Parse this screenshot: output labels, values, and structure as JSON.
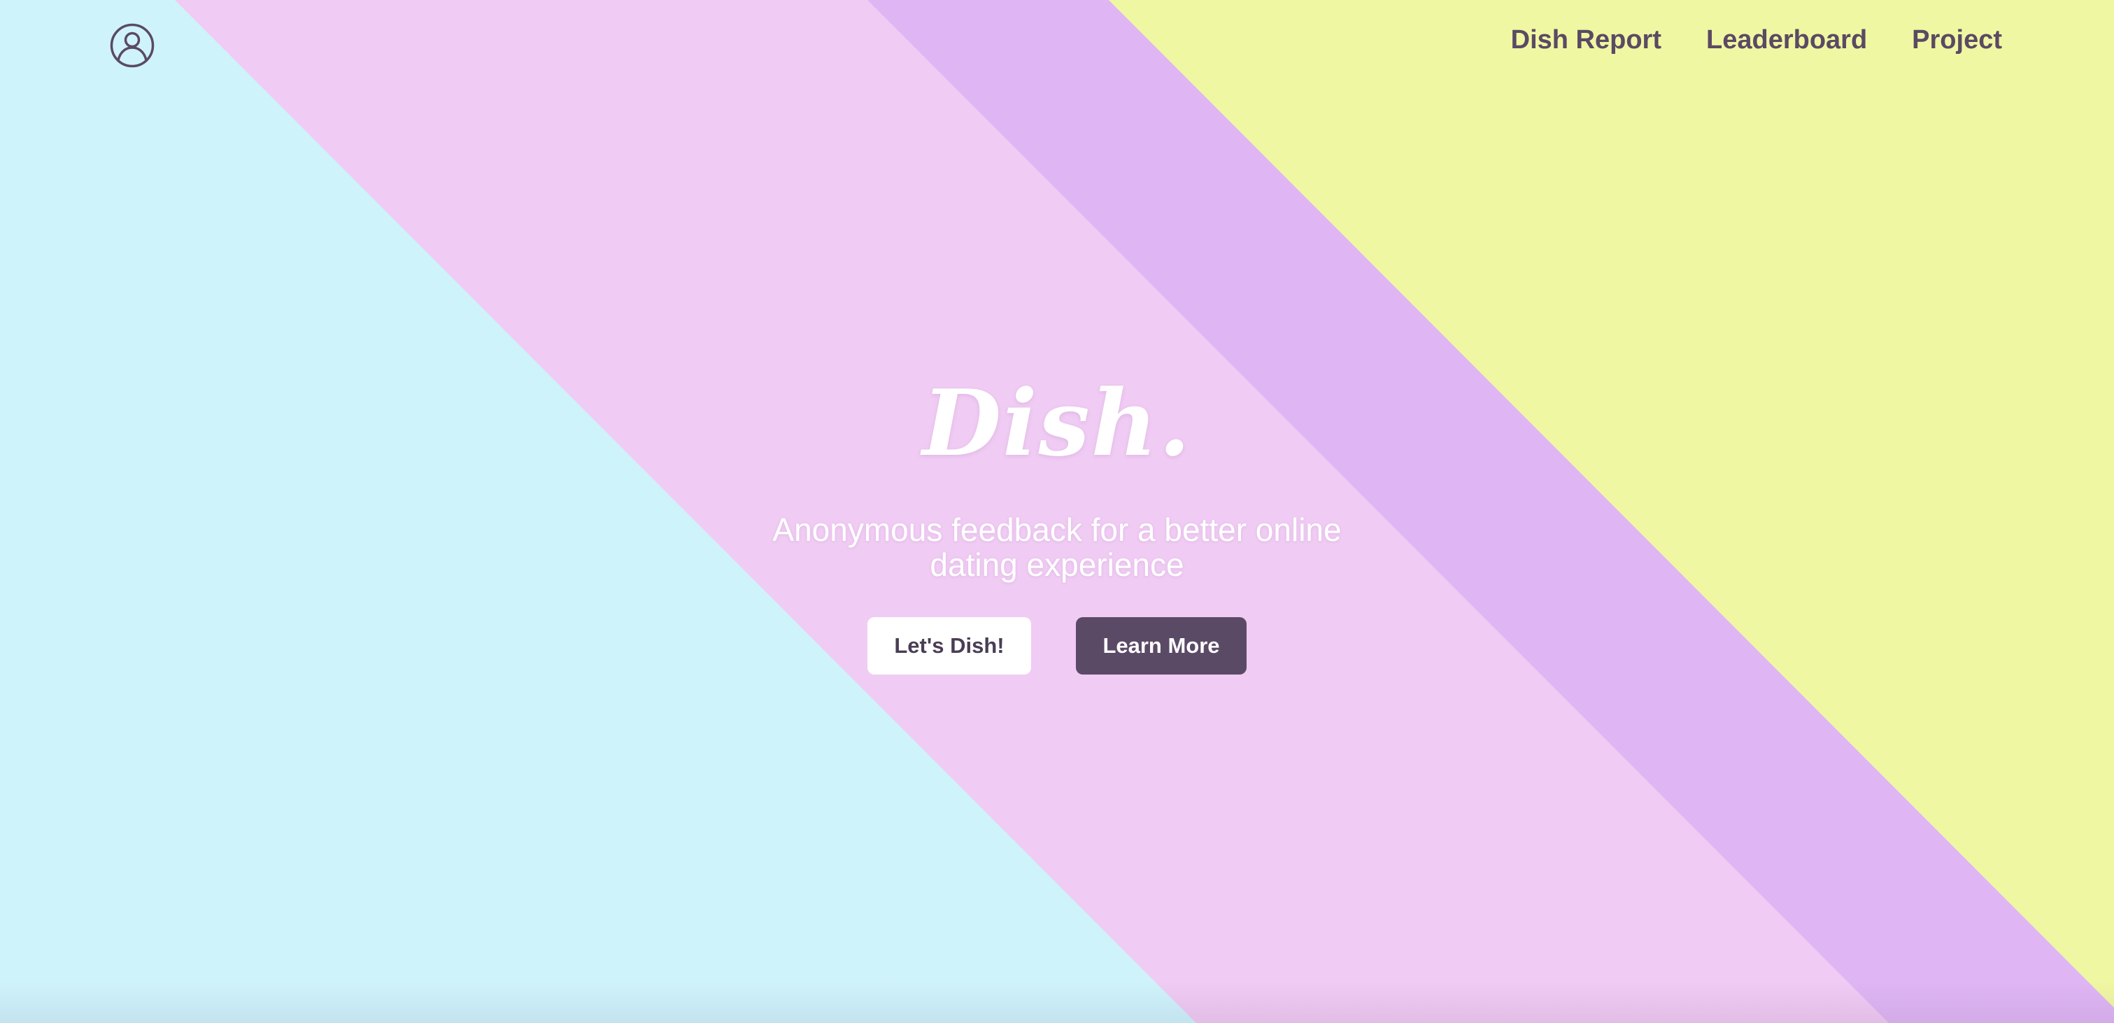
{
  "app": {
    "logo_text": "Dish."
  },
  "header": {
    "profile_icon": "user-circle-icon",
    "nav": [
      {
        "label": "Dish Report"
      },
      {
        "label": "Leaderboard"
      },
      {
        "label": "Project"
      }
    ]
  },
  "hero": {
    "tagline": "Anonymous feedback for a better online dating experience",
    "primary_button": "Let's Dish!",
    "secondary_button": "Learn More"
  },
  "colors": {
    "cyan": "#cff3fb",
    "pink": "#f0cbf3",
    "lavender": "#dfb6f3",
    "yellow": "#f0f7a2",
    "accent": "#5b4a66"
  }
}
